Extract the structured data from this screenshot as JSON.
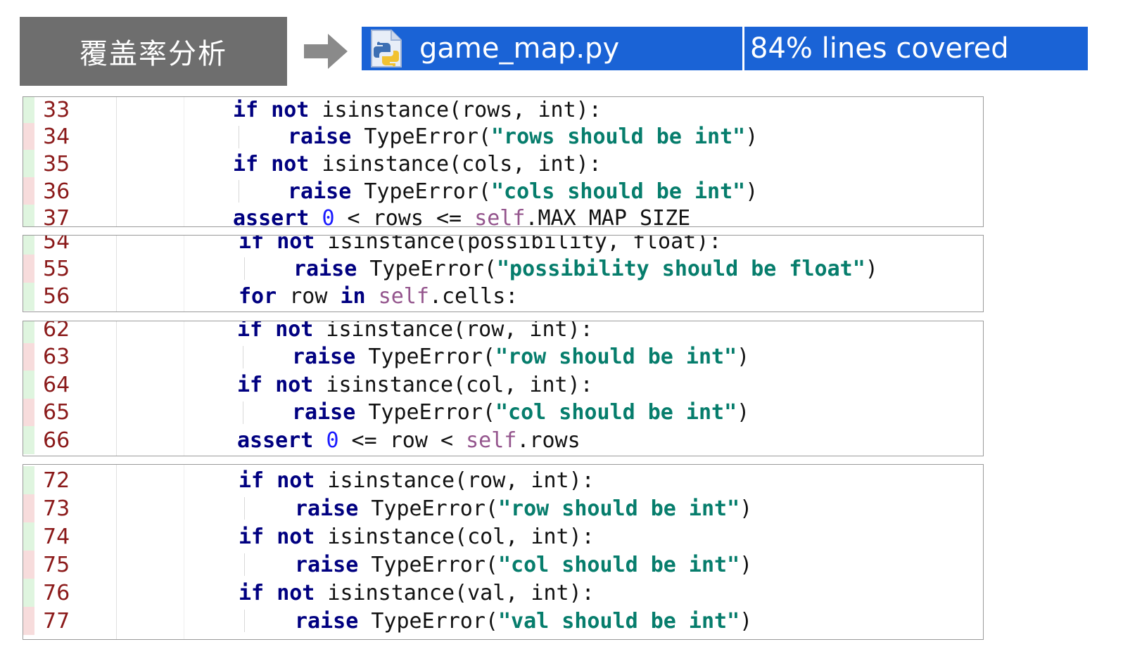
{
  "title": "覆盖率分析",
  "coverage": {
    "file_name": "game_map.py",
    "summary": "84% lines covered",
    "file_icon": "python-file-icon",
    "arrow_icon": "right-arrow-icon"
  },
  "colors": {
    "covered": "#dff5df",
    "missed": "#f7dcdc",
    "coverage_bar": "#1a63d6",
    "title_box": "#6e6e6e"
  },
  "panels": [
    {
      "lines": [
        {
          "no": "33",
          "status": "covered",
          "indent": 1,
          "tokens": [
            [
              "kw",
              "if"
            ],
            [
              "t",
              " "
            ],
            [
              "kw",
              "not"
            ],
            [
              "t",
              " isinstance(rows, int):"
            ]
          ]
        },
        {
          "no": "34",
          "status": "missed",
          "indent": 2,
          "tokens": [
            [
              "kw",
              "raise"
            ],
            [
              "t",
              " TypeError("
            ],
            [
              "str",
              "\"rows should be int\""
            ],
            [
              "t",
              ")"
            ]
          ]
        },
        {
          "no": "35",
          "status": "covered",
          "indent": 1,
          "tokens": [
            [
              "kw",
              "if"
            ],
            [
              "t",
              " "
            ],
            [
              "kw",
              "not"
            ],
            [
              "t",
              " isinstance(cols, int):"
            ]
          ]
        },
        {
          "no": "36",
          "status": "missed",
          "indent": 2,
          "tokens": [
            [
              "kw",
              "raise"
            ],
            [
              "t",
              " TypeError("
            ],
            [
              "str",
              "\"cols should be int\""
            ],
            [
              "t",
              ")"
            ]
          ]
        },
        {
          "no": "37",
          "status": "covered",
          "indent": 1,
          "tokens": [
            [
              "kw",
              "assert"
            ],
            [
              "t",
              " "
            ],
            [
              "num",
              "0"
            ],
            [
              "t",
              " < rows <= "
            ],
            [
              "self",
              "self"
            ],
            [
              "t",
              ".MAX_MAP_SIZE"
            ]
          ]
        }
      ]
    },
    {
      "lines": [
        {
          "no": "54",
          "status": "covered",
          "indent": 1,
          "tokens": [
            [
              "kw",
              "if"
            ],
            [
              "t",
              " "
            ],
            [
              "kw",
              "not"
            ],
            [
              "t",
              " isinstance(possibility, float):"
            ]
          ]
        },
        {
          "no": "55",
          "status": "missed",
          "indent": 2,
          "tokens": [
            [
              "kw",
              "raise"
            ],
            [
              "t",
              " TypeError("
            ],
            [
              "str",
              "\"possibility should be float\""
            ],
            [
              "t",
              ")"
            ]
          ]
        },
        {
          "no": "56",
          "status": "covered",
          "indent": 1,
          "tokens": [
            [
              "kw",
              "for"
            ],
            [
              "t",
              " row "
            ],
            [
              "kw",
              "in"
            ],
            [
              "t",
              " "
            ],
            [
              "self",
              "self"
            ],
            [
              "t",
              ".cells:"
            ]
          ]
        }
      ]
    },
    {
      "lines": [
        {
          "no": "62",
          "status": "covered",
          "indent": 1,
          "tokens": [
            [
              "kw",
              "if"
            ],
            [
              "t",
              " "
            ],
            [
              "kw",
              "not"
            ],
            [
              "t",
              " isinstance(row, int):"
            ]
          ]
        },
        {
          "no": "63",
          "status": "missed",
          "indent": 2,
          "tokens": [
            [
              "kw",
              "raise"
            ],
            [
              "t",
              " TypeError("
            ],
            [
              "str",
              "\"row should be int\""
            ],
            [
              "t",
              ")"
            ]
          ]
        },
        {
          "no": "64",
          "status": "covered",
          "indent": 1,
          "tokens": [
            [
              "kw",
              "if"
            ],
            [
              "t",
              " "
            ],
            [
              "kw",
              "not"
            ],
            [
              "t",
              " isinstance(col, int):"
            ]
          ]
        },
        {
          "no": "65",
          "status": "missed",
          "indent": 2,
          "tokens": [
            [
              "kw",
              "raise"
            ],
            [
              "t",
              " TypeError("
            ],
            [
              "str",
              "\"col should be int\""
            ],
            [
              "t",
              ")"
            ]
          ]
        },
        {
          "no": "66",
          "status": "covered",
          "indent": 1,
          "tokens": [
            [
              "kw",
              "assert"
            ],
            [
              "t",
              " "
            ],
            [
              "num",
              "0"
            ],
            [
              "t",
              " <= row < "
            ],
            [
              "self",
              "self"
            ],
            [
              "t",
              ".rows"
            ]
          ]
        }
      ]
    },
    {
      "lines": [
        {
          "no": "72",
          "status": "covered",
          "indent": 1,
          "tokens": [
            [
              "kw",
              "if"
            ],
            [
              "t",
              " "
            ],
            [
              "kw",
              "not"
            ],
            [
              "t",
              " isinstance(row, int):"
            ]
          ]
        },
        {
          "no": "73",
          "status": "missed",
          "indent": 2,
          "tokens": [
            [
              "kw",
              "raise"
            ],
            [
              "t",
              " TypeError("
            ],
            [
              "str",
              "\"row should be int\""
            ],
            [
              "t",
              ")"
            ]
          ]
        },
        {
          "no": "74",
          "status": "covered",
          "indent": 1,
          "tokens": [
            [
              "kw",
              "if"
            ],
            [
              "t",
              " "
            ],
            [
              "kw",
              "not"
            ],
            [
              "t",
              " isinstance(col, int):"
            ]
          ]
        },
        {
          "no": "75",
          "status": "missed",
          "indent": 2,
          "tokens": [
            [
              "kw",
              "raise"
            ],
            [
              "t",
              " TypeError("
            ],
            [
              "str",
              "\"col should be int\""
            ],
            [
              "t",
              ")"
            ]
          ]
        },
        {
          "no": "76",
          "status": "covered",
          "indent": 1,
          "tokens": [
            [
              "kw",
              "if"
            ],
            [
              "t",
              " "
            ],
            [
              "kw",
              "not"
            ],
            [
              "t",
              " isinstance(val, int):"
            ]
          ]
        },
        {
          "no": "77",
          "status": "missed",
          "indent": 2,
          "tokens": [
            [
              "kw",
              "raise"
            ],
            [
              "t",
              " TypeError("
            ],
            [
              "str",
              "\"val should be int\""
            ],
            [
              "t",
              ")"
            ]
          ]
        }
      ]
    }
  ]
}
